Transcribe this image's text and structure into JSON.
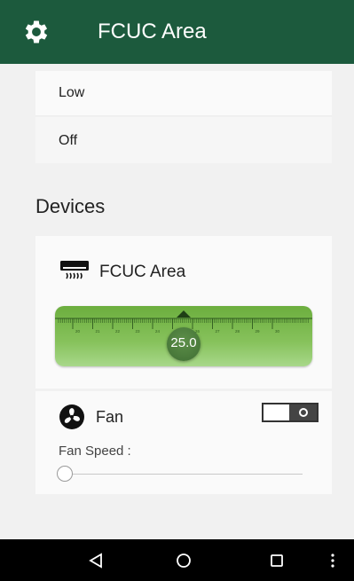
{
  "header": {
    "title": "FCUC Area",
    "settings_icon": "gear-icon"
  },
  "modes": {
    "items": [
      {
        "label": "Low"
      },
      {
        "label": "Off"
      }
    ]
  },
  "devices": {
    "section_title": "Devices",
    "ac": {
      "name": "FCUC Area",
      "icon": "air-conditioner-icon",
      "temperature": "25.0",
      "ruler_ticks": [
        "20",
        "21",
        "22",
        "23",
        "24",
        "25",
        "26",
        "27",
        "28",
        "29",
        "30"
      ]
    },
    "fan": {
      "label": "Fan",
      "icon": "fan-icon",
      "toggle_state": "off",
      "speed_label": "Fan Speed :",
      "speed_level": 0
    }
  },
  "colors": {
    "header_bg": "#1c5a3d",
    "ruler_green": "#7ab852",
    "knob": "#4a7a3c"
  },
  "navbar": {
    "icons": [
      "back-icon",
      "home-icon",
      "recents-icon",
      "more-icon"
    ]
  }
}
